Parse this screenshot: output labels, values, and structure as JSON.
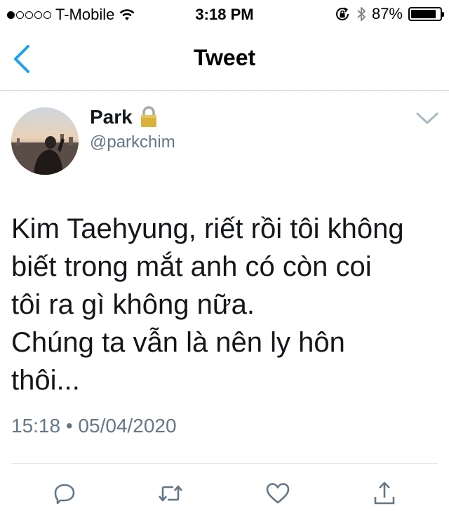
{
  "status_bar": {
    "carrier": "T-Mobile",
    "time": "3:18 PM",
    "battery": "87%",
    "battery_level": 0.87,
    "signal_bars_filled": 1,
    "signal_bars_total": 5
  },
  "nav": {
    "title": "Tweet",
    "back_icon": "chevron-left-icon"
  },
  "tweet": {
    "author_name": "Park",
    "author_handle": "@parkchim",
    "protected_icon": "lock-icon",
    "text_lines": [
      "Kim Taehyung, riết rồi tôi không",
      "biết trong mắt anh có còn coi",
      "tôi ra gì không nữa.",
      "Chúng ta vẫn là nên ly hôn",
      "thôi..."
    ],
    "timestamp": "15:18 • 05/04/2020"
  },
  "actions": [
    {
      "icon": "reply-icon"
    },
    {
      "icon": "retweet-icon"
    },
    {
      "icon": "like-icon"
    },
    {
      "icon": "share-icon"
    }
  ],
  "colors": {
    "accent": "#1da1f2",
    "secondary_text": "#657786",
    "action_icon": "#657786"
  }
}
